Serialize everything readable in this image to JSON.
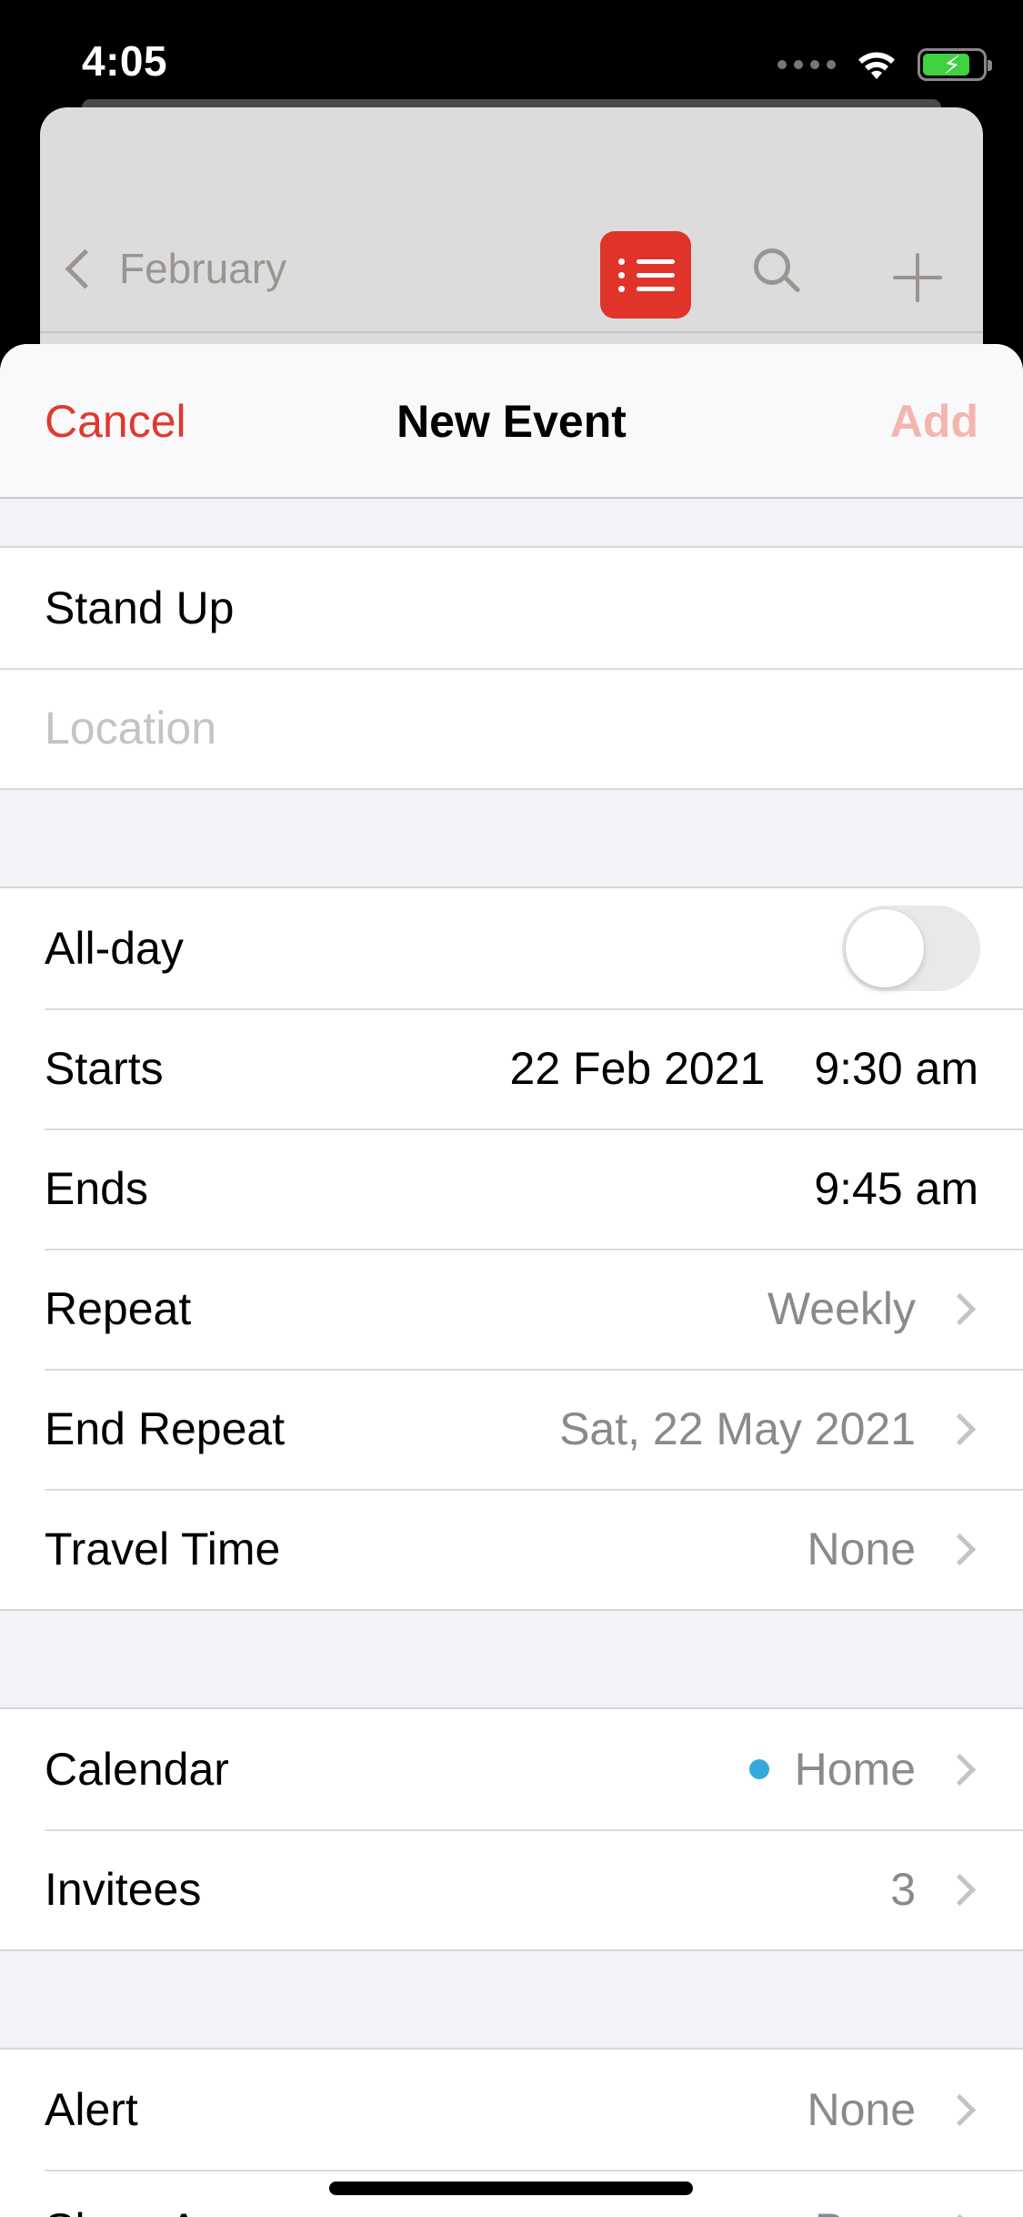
{
  "status_bar": {
    "time": "4:05",
    "battery_percent": 80
  },
  "background": {
    "back_label": "February",
    "list_button_color": "#e0342b"
  },
  "header": {
    "cancel": "Cancel",
    "title": "New Event",
    "add": "Add"
  },
  "event": {
    "title": "Stand Up",
    "location_placeholder": "Location"
  },
  "timing": {
    "all_day_label": "All-day",
    "all_day_on": false,
    "starts_label": "Starts",
    "starts_date": "22 Feb 2021",
    "starts_time": "9:30 am",
    "ends_label": "Ends",
    "ends_time": "9:45 am",
    "repeat_label": "Repeat",
    "repeat_value": "Weekly",
    "end_repeat_label": "End Repeat",
    "end_repeat_value": "Sat, 22 May 2021",
    "travel_label": "Travel Time",
    "travel_value": "None"
  },
  "calendar_group": {
    "calendar_label": "Calendar",
    "calendar_value": "Home",
    "calendar_color": "#34aadc",
    "invitees_label": "Invitees",
    "invitees_value": "3"
  },
  "alert_group": {
    "alert_label": "Alert",
    "alert_value": "None",
    "show_as_label": "Show As",
    "show_as_value": "Busy"
  },
  "colors": {
    "accent": "#e0392f",
    "add_disabled": "#f4b5b0"
  }
}
